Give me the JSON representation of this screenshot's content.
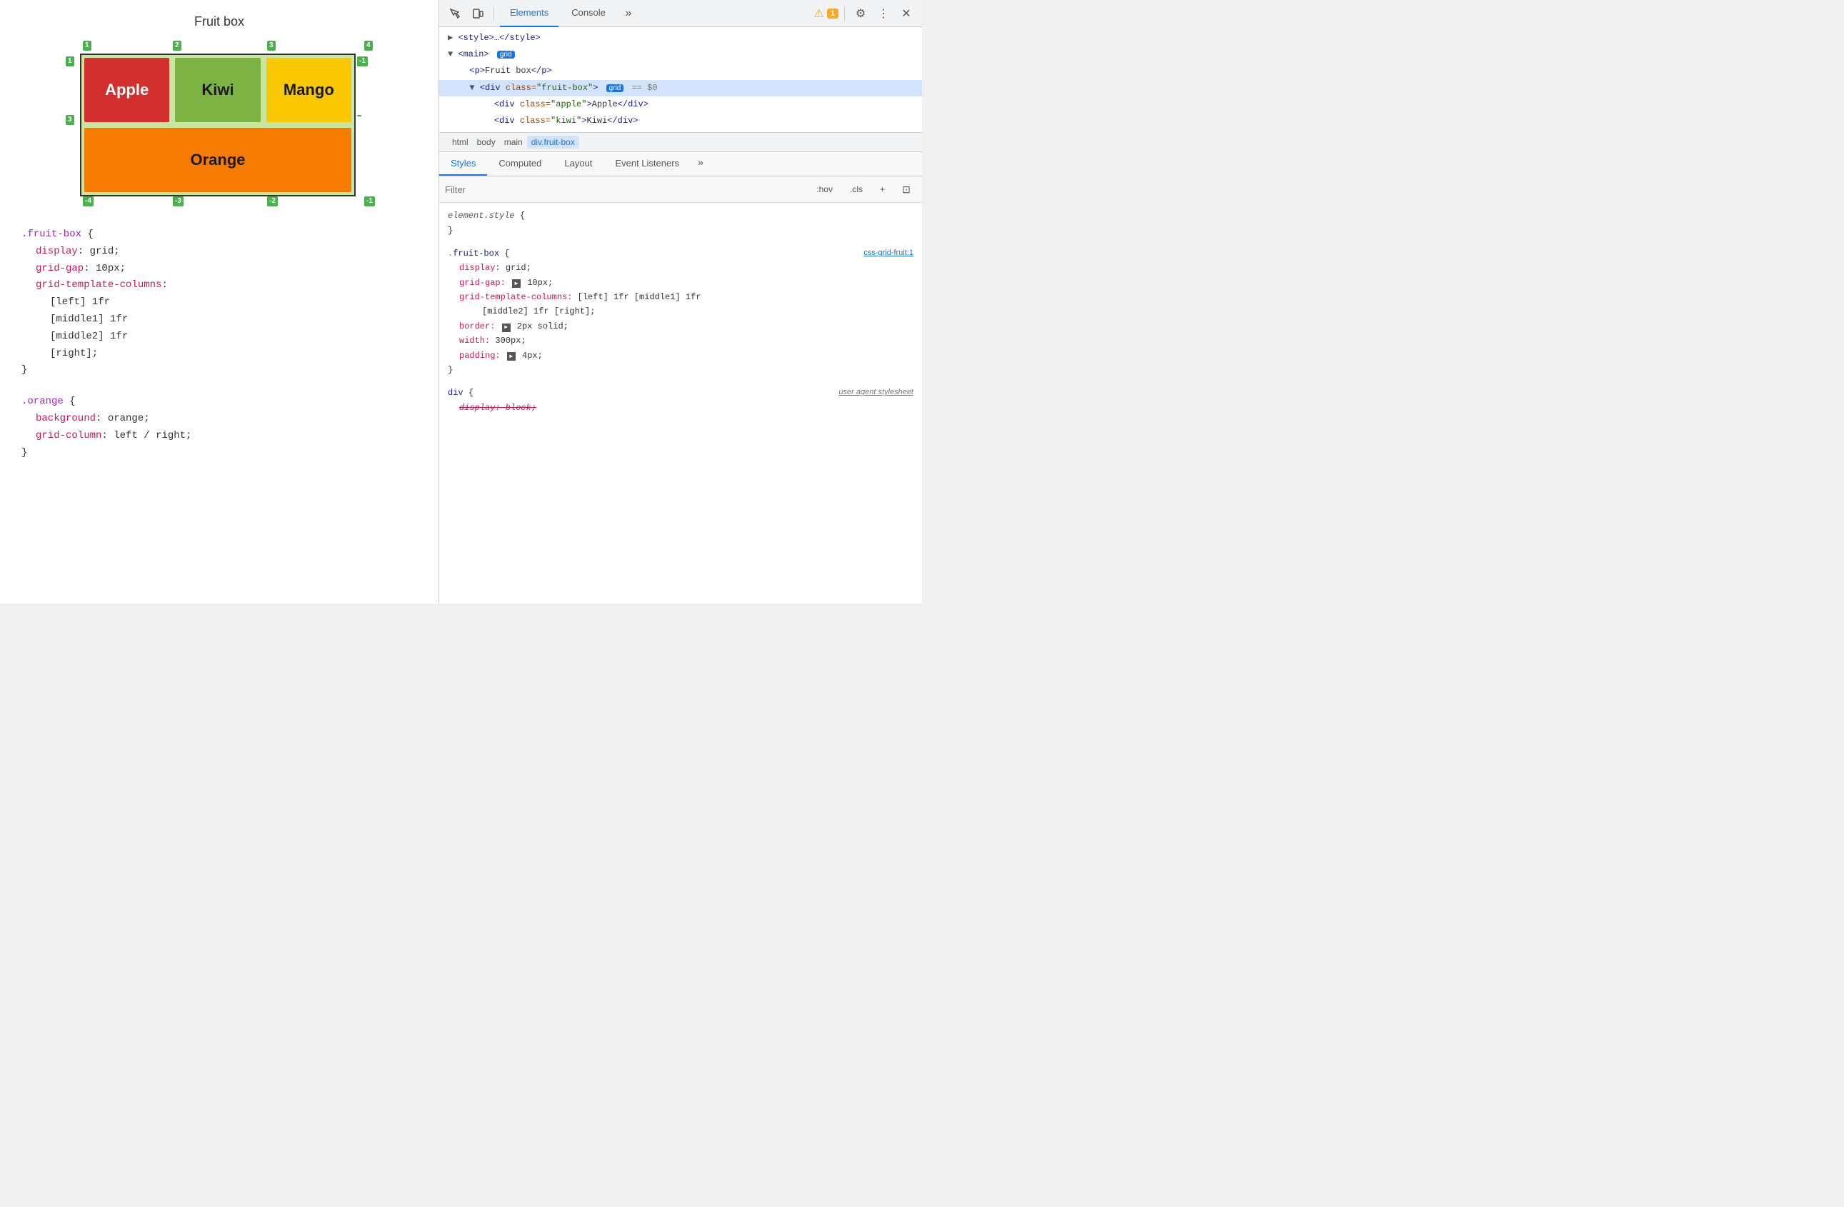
{
  "left": {
    "title": "Fruit box",
    "fruits": [
      {
        "name": "Apple",
        "class": "cell-apple"
      },
      {
        "name": "Kiwi",
        "class": "cell-kiwi"
      },
      {
        "name": "Mango",
        "class": "cell-mango"
      },
      {
        "name": "Orange",
        "class": "cell-orange"
      }
    ],
    "code1": {
      "selector": ".fruit-box",
      "props": [
        {
          "prop": "display",
          "val": "grid;"
        },
        {
          "prop": "grid-gap",
          "val": "10px;"
        },
        {
          "prop": "grid-template-columns",
          "val": ""
        },
        {
          "prop2": "[left] 1fr"
        },
        {
          "prop3": "[middle1] 1fr"
        },
        {
          "prop4": "[middle2] 1fr"
        },
        {
          "prop5": "[right];"
        }
      ]
    },
    "code2": {
      "selector": ".orange",
      "props": [
        {
          "prop": "background",
          "val": "orange;"
        },
        {
          "prop": "grid-column",
          "val": "left / right;"
        }
      ]
    }
  },
  "devtools": {
    "toolbar": {
      "tabs": [
        "Elements",
        "Console"
      ],
      "active_tab": "Elements",
      "warning_count": "1"
    },
    "html_tree": {
      "lines": [
        {
          "indent": 0,
          "content": "▶ <style>…</style>"
        },
        {
          "indent": 0,
          "content": "▼ <main>",
          "badge": "grid"
        },
        {
          "indent": 1,
          "content": "<p>Fruit box</p>"
        },
        {
          "indent": 1,
          "content": "▼ <div class=\"fruit-box\">",
          "selected": true,
          "grid_badge": true,
          "dollar_zero": true
        },
        {
          "indent": 2,
          "content": "<div class=\"apple\">Apple</div>"
        },
        {
          "indent": 2,
          "content": "<div class=\"kiwi\">Kiwi</div>"
        }
      ]
    },
    "breadcrumb": [
      "html",
      "body",
      "main",
      "div.fruit-box"
    ],
    "active_breadcrumb": "div.fruit-box",
    "styles_tabs": [
      "Styles",
      "Computed",
      "Layout",
      "Event Listeners"
    ],
    "active_styles_tab": "Styles",
    "filter_placeholder": "Filter",
    "toolbar_buttons": [
      ":hov",
      ".cls",
      "+"
    ],
    "style_rules": [
      {
        "selector": "element.style {",
        "source": "",
        "props": []
      },
      {
        "selector": ".fruit-box {",
        "source": "css-grid-fruit:1",
        "props": [
          {
            "name": "display",
            "value": "grid;",
            "color": "red"
          },
          {
            "name": "grid-gap:",
            "value": "▶ 10px;",
            "color": "red"
          },
          {
            "name": "grid-template-columns:",
            "value": "[left] 1fr [middle1] 1fr",
            "color": "red",
            "value2": "[middle2] 1fr [right];"
          },
          {
            "name": "border:",
            "value": "▶ 2px solid;",
            "color": "red"
          },
          {
            "name": "width:",
            "value": "300px;",
            "color": "red"
          },
          {
            "name": "padding:",
            "value": "▶ 4px;",
            "color": "red"
          }
        ]
      },
      {
        "selector": "div {",
        "source": "user agent stylesheet",
        "source_italic": true,
        "props": [
          {
            "name": "display: block;",
            "strikethrough": true
          }
        ]
      }
    ]
  }
}
